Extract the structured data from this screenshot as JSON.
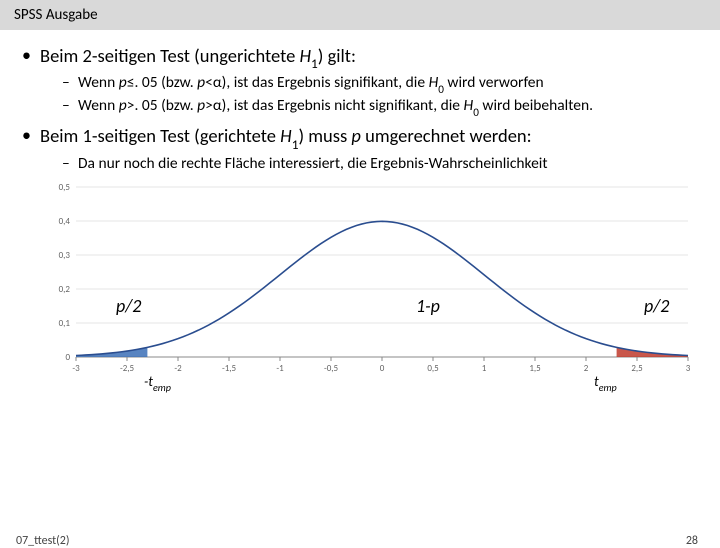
{
  "header": {
    "title": "SPSS Ausgabe"
  },
  "bullets": {
    "b1_pre": "Beim 2-seitigen Test (ungerichtete ",
    "b1_h": "H",
    "b1_sub": "1",
    "b1_post": ") gilt:",
    "s1a_pre": "Wenn ",
    "s1a_p": "p",
    "s1a_mid1": "≤. 05 (bzw. ",
    "s1a_p2": "p",
    "s1a_mid2": "<α), ist das Ergebnis signifikant, die ",
    "s1a_h": "H",
    "s1a_sub": "0",
    "s1a_post": " wird verworfen",
    "s1b_pre": "Wenn ",
    "s1b_p": "p",
    "s1b_mid1": ">. 05 (bzw. ",
    "s1b_p2": "p",
    "s1b_mid2": ">α), ist das Ergebnis nicht signifikant, die ",
    "s1b_h": "H",
    "s1b_sub": "0",
    "s1b_post": " wird beibehalten.",
    "b2_pre": "Beim 1-seitigen Test (gerichtete ",
    "b2_h": "H",
    "b2_sub": "1",
    "b2_mid": ") muss ",
    "b2_p": "p",
    "b2_post": " umgerechnet werden:",
    "s2a": "Da nur noch die rechte Fläche interessiert, die Ergebnis-Wahrscheinlichkeit"
  },
  "chart_data": {
    "type": "line",
    "title": "",
    "xlabel": "",
    "ylabel": "",
    "xlim": [
      -3,
      3
    ],
    "ylim": [
      0,
      0.5
    ],
    "xticks": [
      -3,
      -2.5,
      -2,
      -1.5,
      -1,
      -0.5,
      0,
      0.5,
      1,
      1.5,
      2,
      2.5,
      3
    ],
    "yticks": [
      0,
      0.1,
      0.2,
      0.3,
      0.4,
      0.5
    ],
    "ytick_labels": [
      "0",
      "0,1",
      "0,2",
      "0,3",
      "0,4",
      "0,5"
    ],
    "series": [
      {
        "name": "normal-pdf",
        "x": [
          -3,
          -2.5,
          -2,
          -1.5,
          -1,
          -0.5,
          0,
          0.5,
          1,
          1.5,
          2,
          2.5,
          3
        ],
        "values": [
          0.004,
          0.018,
          0.054,
          0.13,
          0.242,
          0.352,
          0.399,
          0.352,
          0.242,
          0.13,
          0.054,
          0.018,
          0.004
        ]
      }
    ],
    "shaded": [
      {
        "name": "left-tail",
        "color": "#3b6fb6",
        "x_from": -3,
        "x_to": -2.3
      },
      {
        "name": "right-tail",
        "color": "#c0392b",
        "x_from": 2.3,
        "x_to": 3
      }
    ],
    "annotations": {
      "left_region": "p/2",
      "center_region": "1-p",
      "right_region": "p/2",
      "left_marker_pre": "-t",
      "left_marker_sub": "emp",
      "right_marker_pre": "t",
      "right_marker_sub": "emp"
    }
  },
  "footer": {
    "left": "07_ttest(2)",
    "right": "28"
  }
}
